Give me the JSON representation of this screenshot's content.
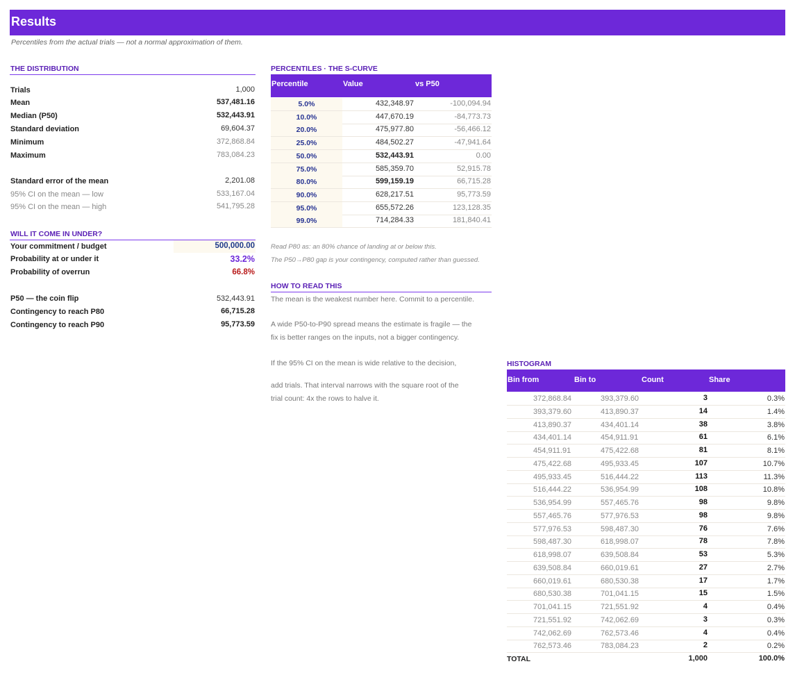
{
  "header": {
    "title": "Results",
    "subtitle": "Percentiles from the actual trials — not a normal approximation of them."
  },
  "distribution": {
    "heading": "THE DISTRIBUTION",
    "rows": [
      {
        "label": "Trials",
        "value": "1,000"
      },
      {
        "label": "Mean",
        "value": "537,481.16"
      },
      {
        "label": "Median (P50)",
        "value": "532,443.91"
      },
      {
        "label": "Standard deviation",
        "value": "69,604.37"
      },
      {
        "label": "Minimum",
        "value": "372,868.84"
      },
      {
        "label": "Maximum",
        "value": "783,084.23"
      }
    ],
    "se_rows": [
      {
        "label": "Standard error of the mean",
        "value": "2,201.08"
      },
      {
        "label": "95% CI on the mean — low",
        "value": "533,167.04"
      },
      {
        "label": "95% CI on the mean — high",
        "value": "541,795.28"
      }
    ]
  },
  "under": {
    "heading": "WILL IT COME IN UNDER?",
    "commitment_label": "Your commitment / budget",
    "commitment_value": "500,000.00",
    "prob_under_label": "Probability at or under it",
    "prob_under_value": "33.2%",
    "prob_over_label": "Probability of overrun",
    "prob_over_value": "66.8%",
    "p50_label": "P50 — the coin flip",
    "p50_value": "532,443.91",
    "p80_label": "Contingency to reach P80",
    "p80_value": "66,715.28",
    "p90_label": "Contingency to reach P90",
    "p90_value": "95,773.59"
  },
  "percentiles": {
    "heading": "PERCENTILES · THE S-CURVE",
    "columns": [
      "Percentile",
      "Value",
      "vs P50"
    ],
    "rows": [
      {
        "pct": "5.0%",
        "value": "432,348.97",
        "vs": "-100,094.94"
      },
      {
        "pct": "10.0%",
        "value": "447,670.19",
        "vs": "-84,773.73"
      },
      {
        "pct": "20.0%",
        "value": "475,977.80",
        "vs": "-56,466.12"
      },
      {
        "pct": "25.0%",
        "value": "484,502.27",
        "vs": "-47,941.64"
      },
      {
        "pct": "50.0%",
        "value": "532,443.91",
        "vs": "0.00"
      },
      {
        "pct": "75.0%",
        "value": "585,359.70",
        "vs": "52,915.78"
      },
      {
        "pct": "80.0%",
        "value": "599,159.19",
        "vs": "66,715.28"
      },
      {
        "pct": "90.0%",
        "value": "628,217.51",
        "vs": "95,773.59"
      },
      {
        "pct": "95.0%",
        "value": "655,572.26",
        "vs": "123,128.35"
      },
      {
        "pct": "99.0%",
        "value": "714,284.33",
        "vs": "181,840.41"
      }
    ],
    "note1": "Read P80 as: an 80% chance of landing at or below this.",
    "note2": "The P50→P80 gap is your contingency, computed rather than guessed."
  },
  "howto": {
    "heading": "HOW TO READ THIS",
    "line1": "The mean is the weakest number here. Commit to a percentile.",
    "line2a": "A wide P50-to-P90 spread means the estimate is fragile — the",
    "line2b": "fix is better ranges on the inputs, not a bigger contingency.",
    "line3a": "If the 95% CI on the mean is wide relative to the decision,",
    "line3b": "add trials. That interval narrows with the square root of the",
    "line3c": "trial count: 4x the rows to halve it."
  },
  "histogram": {
    "heading": "HISTOGRAM",
    "columns": [
      "Bin from",
      "Bin to",
      "Count",
      "Share"
    ],
    "rows": [
      {
        "from": "372,868.84",
        "to": "393,379.60",
        "count": "3",
        "share": "0.3%"
      },
      {
        "from": "393,379.60",
        "to": "413,890.37",
        "count": "14",
        "share": "1.4%"
      },
      {
        "from": "413,890.37",
        "to": "434,401.14",
        "count": "38",
        "share": "3.8%"
      },
      {
        "from": "434,401.14",
        "to": "454,911.91",
        "count": "61",
        "share": "6.1%"
      },
      {
        "from": "454,911.91",
        "to": "475,422.68",
        "count": "81",
        "share": "8.1%"
      },
      {
        "from": "475,422.68",
        "to": "495,933.45",
        "count": "107",
        "share": "10.7%"
      },
      {
        "from": "495,933.45",
        "to": "516,444.22",
        "count": "113",
        "share": "11.3%"
      },
      {
        "from": "516,444.22",
        "to": "536,954.99",
        "count": "108",
        "share": "10.8%"
      },
      {
        "from": "536,954.99",
        "to": "557,465.76",
        "count": "98",
        "share": "9.8%"
      },
      {
        "from": "557,465.76",
        "to": "577,976.53",
        "count": "98",
        "share": "9.8%"
      },
      {
        "from": "577,976.53",
        "to": "598,487.30",
        "count": "76",
        "share": "7.6%"
      },
      {
        "from": "598,487.30",
        "to": "618,998.07",
        "count": "78",
        "share": "7.8%"
      },
      {
        "from": "618,998.07",
        "to": "639,508.84",
        "count": "53",
        "share": "5.3%"
      },
      {
        "from": "639,508.84",
        "to": "660,019.61",
        "count": "27",
        "share": "2.7%"
      },
      {
        "from": "660,019.61",
        "to": "680,530.38",
        "count": "17",
        "share": "1.7%"
      },
      {
        "from": "680,530.38",
        "to": "701,041.15",
        "count": "15",
        "share": "1.5%"
      },
      {
        "from": "701,041.15",
        "to": "721,551.92",
        "count": "4",
        "share": "0.4%"
      },
      {
        "from": "721,551.92",
        "to": "742,062.69",
        "count": "3",
        "share": "0.3%"
      },
      {
        "from": "742,062.69",
        "to": "762,573.46",
        "count": "4",
        "share": "0.4%"
      },
      {
        "from": "762,573.46",
        "to": "783,084.23",
        "count": "2",
        "share": "0.2%"
      }
    ],
    "total_label": "TOTAL",
    "total_count": "1,000",
    "total_share": "100.0%"
  },
  "colors": {
    "accent": "#6d28d9",
    "heading": "#5b21b6",
    "percentile_text": "#283593",
    "overrun": "#b91c1c"
  }
}
